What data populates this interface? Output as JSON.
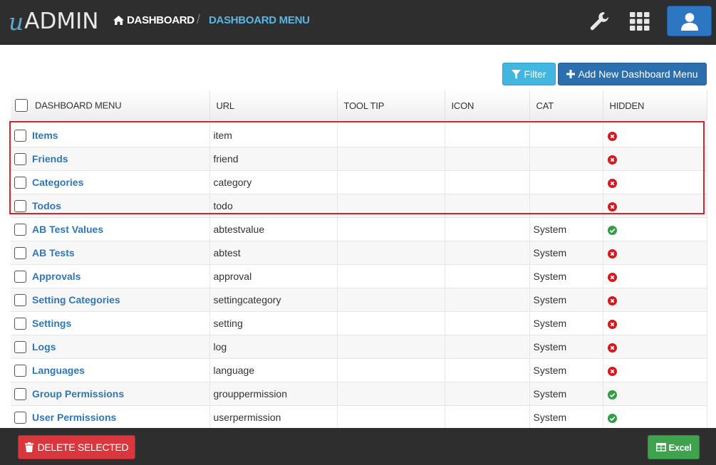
{
  "app": {
    "logo_u": "u",
    "logo_rest": "ADMIN"
  },
  "breadcrumb": {
    "home_label": "DASHBOARD",
    "separator": "/",
    "current_label": "DASHBOARD MENU"
  },
  "toolbar": {
    "icons": [
      "wrench-icon",
      "grid-icon",
      "user-icon"
    ],
    "filter_label": "Filter",
    "add_label": "Add New Dashboard Menu"
  },
  "table": {
    "columns": [
      "DASHBOARD MENU",
      "URL",
      "TOOL TIP",
      "ICON",
      "CAT",
      "HIDDEN"
    ],
    "rows": [
      {
        "name": "Items",
        "url": "item",
        "tooltip": "",
        "icon": "",
        "cat": "",
        "hidden": false
      },
      {
        "name": "Friends",
        "url": "friend",
        "tooltip": "",
        "icon": "",
        "cat": "",
        "hidden": false
      },
      {
        "name": "Categories",
        "url": "category",
        "tooltip": "",
        "icon": "",
        "cat": "",
        "hidden": false
      },
      {
        "name": "Todos",
        "url": "todo",
        "tooltip": "",
        "icon": "",
        "cat": "",
        "hidden": false
      },
      {
        "name": "AB Test Values",
        "url": "abtestvalue",
        "tooltip": "",
        "icon": "",
        "cat": "System",
        "hidden": true
      },
      {
        "name": "AB Tests",
        "url": "abtest",
        "tooltip": "",
        "icon": "",
        "cat": "System",
        "hidden": false
      },
      {
        "name": "Approvals",
        "url": "approval",
        "tooltip": "",
        "icon": "",
        "cat": "System",
        "hidden": false
      },
      {
        "name": "Setting Categories",
        "url": "settingcategory",
        "tooltip": "",
        "icon": "",
        "cat": "System",
        "hidden": false
      },
      {
        "name": "Settings",
        "url": "setting",
        "tooltip": "",
        "icon": "",
        "cat": "System",
        "hidden": false
      },
      {
        "name": "Logs",
        "url": "log",
        "tooltip": "",
        "icon": "",
        "cat": "System",
        "hidden": false
      },
      {
        "name": "Languages",
        "url": "language",
        "tooltip": "",
        "icon": "",
        "cat": "System",
        "hidden": false
      },
      {
        "name": "Group Permissions",
        "url": "grouppermission",
        "tooltip": "",
        "icon": "",
        "cat": "System",
        "hidden": true
      },
      {
        "name": "User Permissions",
        "url": "userpermission",
        "tooltip": "",
        "icon": "",
        "cat": "System",
        "hidden": true
      }
    ]
  },
  "footer": {
    "delete_label": "DELETE SELECTED",
    "excel_label": "Excel"
  },
  "colors": {
    "topbar": "#2e2e2e",
    "link": "#2f77b7",
    "highlight": "#d8212b",
    "hidden_false": "#d6181e",
    "hidden_true": "#2ea043"
  }
}
